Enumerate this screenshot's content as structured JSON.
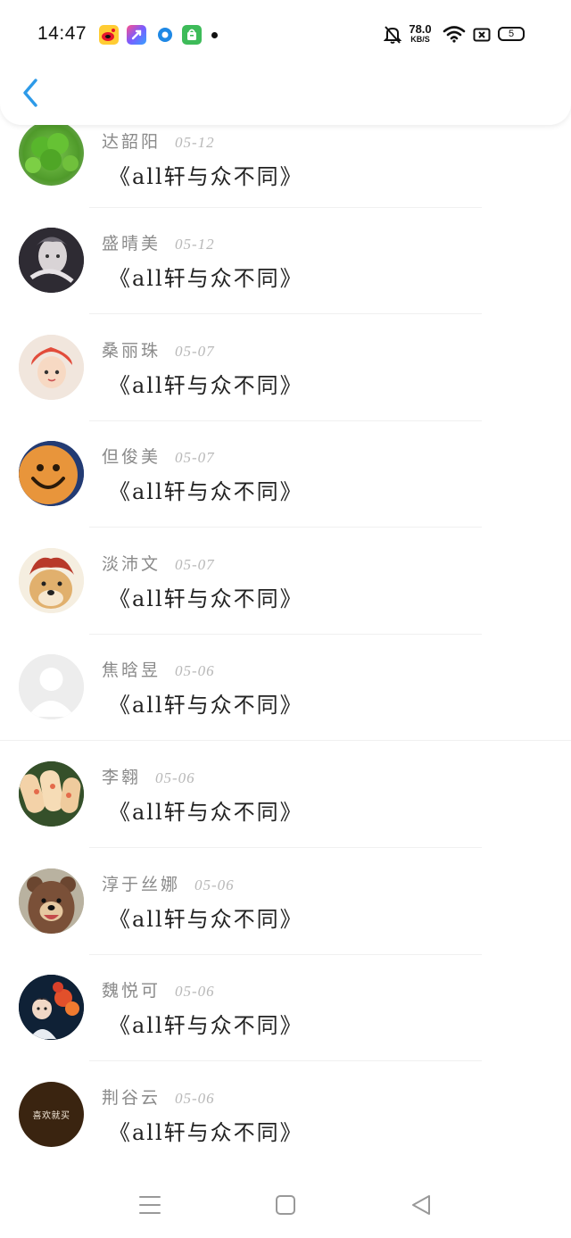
{
  "status_bar": {
    "time": "14:47",
    "net_speed_value": "78.0",
    "net_speed_unit": "KB/S",
    "battery_level": "5",
    "notification_icons": [
      "weibo-icon",
      "launcher-icon",
      "browser-icon",
      "app-market-icon"
    ]
  },
  "header": {
    "back_icon": "chevron-left-icon",
    "accent_color": "#2d9ae8"
  },
  "comments": [
    {
      "name": "达韶阳",
      "date": "05-12",
      "text": "《all轩与众不同》",
      "avatar": "clover-leaves"
    },
    {
      "name": "盛晴美",
      "date": "05-12",
      "text": "《all轩与众不同》",
      "avatar": "anime-girl-dark"
    },
    {
      "name": "桑丽珠",
      "date": "05-07",
      "text": "《all轩与众不同》",
      "avatar": "anime-girl-ponyo"
    },
    {
      "name": "但俊美",
      "date": "05-07",
      "text": "《all轩与众不同》",
      "avatar": "smiley-cookie"
    },
    {
      "name": "淡沛文",
      "date": "05-07",
      "text": "《all轩与众不同》",
      "avatar": "doge-red-hair"
    },
    {
      "name": "焦晗昱",
      "date": "05-06",
      "text": "《all轩与众不同》",
      "avatar": "default-avatar"
    },
    {
      "name": "李翱",
      "date": "05-06",
      "text": "《all轩与众不同》",
      "avatar": "spring-rolls"
    },
    {
      "name": "淳于丝娜",
      "date": "05-06",
      "text": "《all轩与众不同》",
      "avatar": "cartoon-bear"
    },
    {
      "name": "魏悦可",
      "date": "05-06",
      "text": "《all轩与众不同》",
      "avatar": "boy-with-flowers"
    },
    {
      "name": "荆谷云",
      "date": "05-06",
      "text": "《all轩与众不同》",
      "avatar": "text-avatar",
      "avatar_text": "喜欢就买"
    }
  ],
  "nav_bar": {
    "menu_icon": "menu-icon",
    "home_icon": "home-square-icon",
    "back_icon": "back-triangle-icon"
  }
}
